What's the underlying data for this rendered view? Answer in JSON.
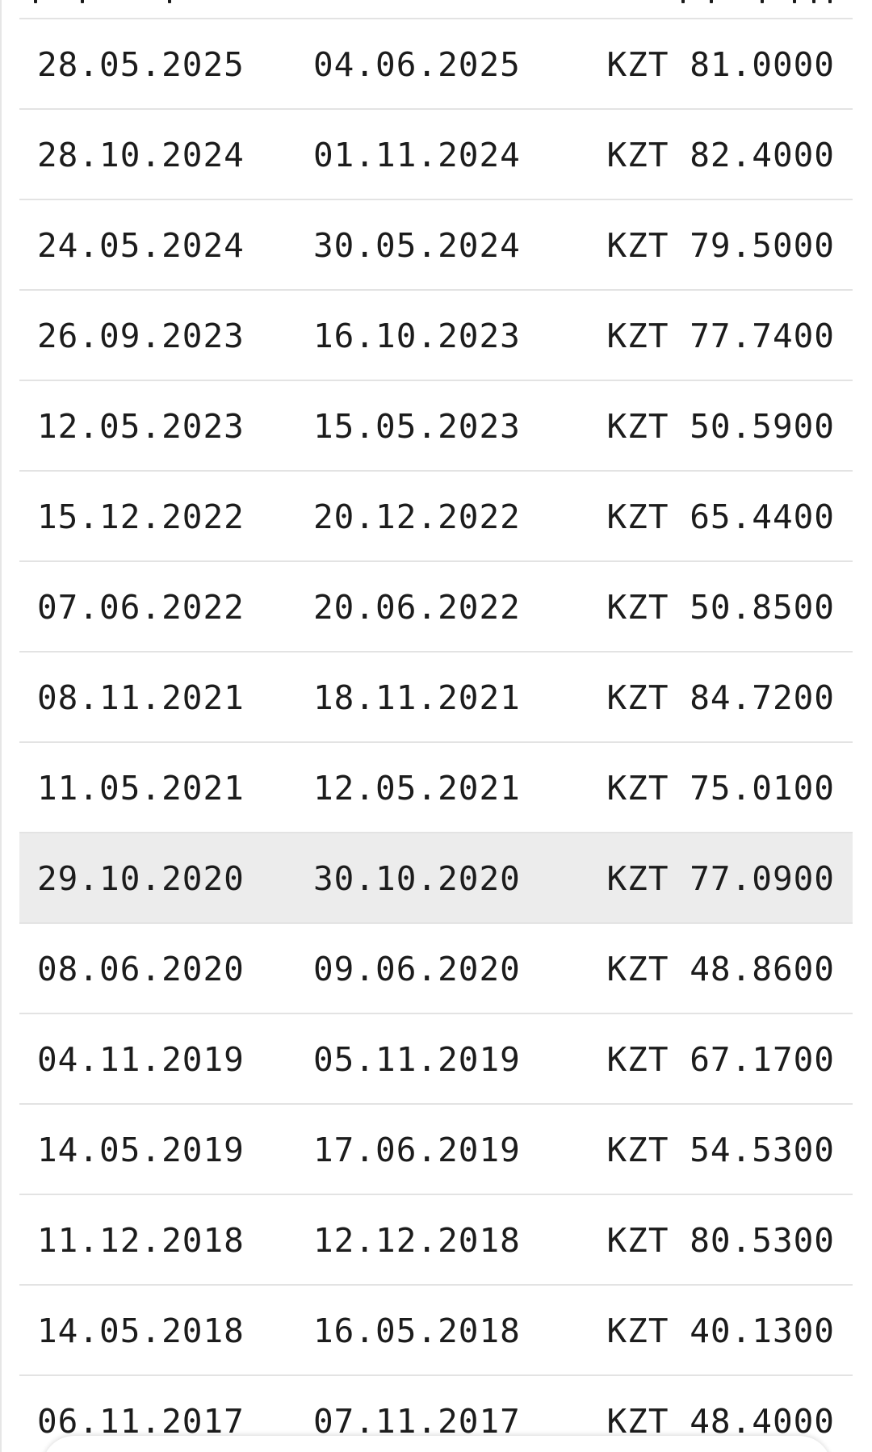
{
  "table": {
    "rows": [
      {
        "date_1": "28.05.2025",
        "date_2": "04.06.2025",
        "currency": "KZT",
        "amount": "81.0000"
      },
      {
        "date_1": "28.10.2024",
        "date_2": "01.11.2024",
        "currency": "KZT",
        "amount": "82.4000"
      },
      {
        "date_1": "24.05.2024",
        "date_2": "30.05.2024",
        "currency": "KZT",
        "amount": "79.5000"
      },
      {
        "date_1": "26.09.2023",
        "date_2": "16.10.2023",
        "currency": "KZT",
        "amount": "77.7400"
      },
      {
        "date_1": "12.05.2023",
        "date_2": "15.05.2023",
        "currency": "KZT",
        "amount": "50.5900"
      },
      {
        "date_1": "15.12.2022",
        "date_2": "20.12.2022",
        "currency": "KZT",
        "amount": "65.4400"
      },
      {
        "date_1": "07.06.2022",
        "date_2": "20.06.2022",
        "currency": "KZT",
        "amount": "50.8500"
      },
      {
        "date_1": "08.11.2021",
        "date_2": "18.11.2021",
        "currency": "KZT",
        "amount": "84.7200"
      },
      {
        "date_1": "11.05.2021",
        "date_2": "12.05.2021",
        "currency": "KZT",
        "amount": "75.0100"
      },
      {
        "date_1": "29.10.2020",
        "date_2": "30.10.2020",
        "currency": "KZT",
        "amount": "77.0900",
        "highlighted": true
      },
      {
        "date_1": "08.06.2020",
        "date_2": "09.06.2020",
        "currency": "KZT",
        "amount": "48.8600"
      },
      {
        "date_1": "04.11.2019",
        "date_2": "05.11.2019",
        "currency": "KZT",
        "amount": "67.1700"
      },
      {
        "date_1": "14.05.2019",
        "date_2": "17.06.2019",
        "currency": "KZT",
        "amount": "54.5300"
      },
      {
        "date_1": "11.12.2018",
        "date_2": "12.12.2018",
        "currency": "KZT",
        "amount": "80.5300"
      },
      {
        "date_1": "14.05.2018",
        "date_2": "16.05.2018",
        "currency": "KZT",
        "amount": "40.1300"
      },
      {
        "date_1": "06.11.2017",
        "date_2": "07.11.2017",
        "currency": "KZT",
        "amount": "48.4000"
      }
    ]
  },
  "colors": {
    "text": "#1c1c1c",
    "divider": "#e3e3e3",
    "highlight_row": "#ececec",
    "background": "#ffffff"
  }
}
